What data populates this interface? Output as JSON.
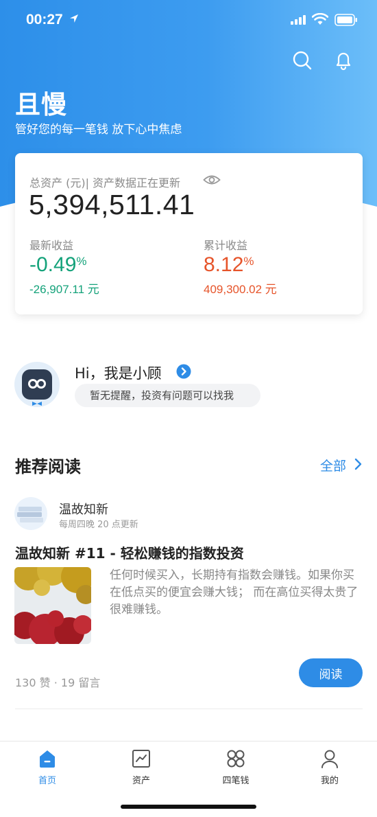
{
  "status_bar": {
    "time": "00:27"
  },
  "header": {
    "app_title": "且慢",
    "subtitle": "管好您的每一笔钱 放下心中焦虑"
  },
  "asset_card": {
    "label": "总资产 (元)| 资产数据正在更新",
    "total": "5,394,511.41",
    "latest": {
      "label": "最新收益",
      "percent": "-0.49",
      "percent_unit": "%",
      "amount": "-26,907.11 元",
      "color": "#14a27a"
    },
    "cumulative": {
      "label": "累计收益",
      "percent": "8.12",
      "percent_unit": "%",
      "amount": "409,300.02 元",
      "color": "#e6542a"
    }
  },
  "assistant": {
    "greeting": "Hi，我是小顾",
    "message": "暂无提醒，投资有问题可以找我"
  },
  "recommended": {
    "title": "推荐阅读",
    "all_label": "全部",
    "article": {
      "source_name": "温故知新",
      "source_schedule": "每周四晚 20 点更新",
      "title": "温故知新 #11 - 轻松赚钱的指数投资",
      "excerpt": "任何时候买入，长期持有指数会赚钱。如果你买在低点买的便宜会赚大钱； 而在高位买得太贵了很难赚钱。",
      "stats": "130 赞 · 19 留言",
      "read_label": "阅读"
    }
  },
  "tab_bar": {
    "tabs": [
      {
        "label": "首页",
        "icon": "home-icon",
        "active": true
      },
      {
        "label": "资产",
        "icon": "chart-icon",
        "active": false
      },
      {
        "label": "四笔钱",
        "icon": "grid-icon",
        "active": false
      },
      {
        "label": "我的",
        "icon": "person-icon",
        "active": false
      }
    ]
  },
  "colors": {
    "accent": "#2e8ce6",
    "gain": "#e6542a",
    "loss": "#14a27a"
  }
}
